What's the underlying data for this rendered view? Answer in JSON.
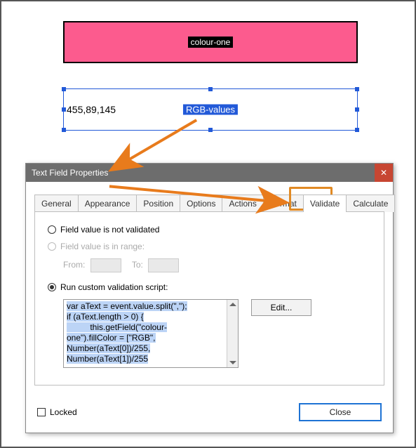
{
  "fields": {
    "colour_one_label": "colour-one",
    "rgb_label": "RGB-values",
    "rgb_value": "455,89,145"
  },
  "dialog": {
    "title": "Text Field Properties",
    "tabs": {
      "general": "General",
      "appearance": "Appearance",
      "position": "Position",
      "options": "Options",
      "actions": "Actions",
      "format": "Format",
      "validate": "Validate",
      "calculate": "Calculate"
    },
    "validate": {
      "opt_none": "Field value is not validated",
      "opt_range": "Field value is in range:",
      "from": "From:",
      "to": "To:",
      "opt_script": "Run custom validation script:",
      "edit_btn": "Edit...",
      "code": [
        "var aText = event.value.split(\",\");",
        "if (aText.length > 0) {",
        "          this.getField(\"colour-",
        "one\").fillColor = [\"RGB\",",
        "Number(aText[0])/255,",
        "Number(aText[1])/255"
      ]
    },
    "footer": {
      "locked": "Locked",
      "close": "Close"
    }
  }
}
